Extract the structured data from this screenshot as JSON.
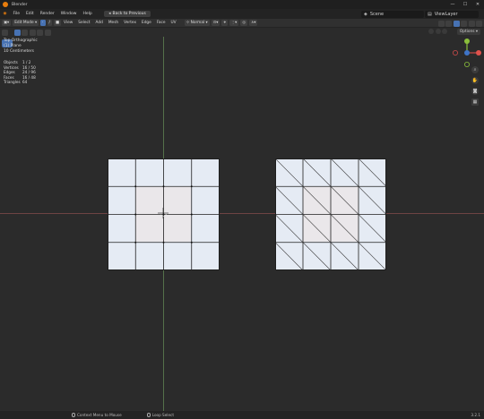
{
  "window": {
    "title": "Blender",
    "buttons": [
      "—",
      "☐",
      "✕"
    ]
  },
  "menubar": {
    "items": [
      "File",
      "Edit",
      "Render",
      "Window",
      "Help"
    ],
    "back_button": "Back to Previous",
    "scene": "Scene",
    "view_layer": "ViewLayer"
  },
  "header": {
    "mode": "Edit Mode",
    "menus": [
      "View",
      "Select",
      "Add",
      "Mesh",
      "Vertex",
      "Edge",
      "Face",
      "UV"
    ],
    "orientation": "Normal"
  },
  "options_label": "Options",
  "overlay": {
    "view": "Top Orthographic",
    "object": "(1) Plane",
    "scale": "10 Centimeters"
  },
  "stats": [
    {
      "label": "Objects",
      "value": "1 / 2"
    },
    {
      "label": "Vertices",
      "value": "16 / 50"
    },
    {
      "label": "Edges",
      "value": "24 / 96"
    },
    {
      "label": "Faces",
      "value": "16 / 48"
    },
    {
      "label": "Triangles",
      "value": "64"
    }
  ],
  "statusbar": {
    "item1": "Context Menu to Mouse",
    "item2": "Loop Select",
    "version": "3.2.1"
  },
  "colors": {
    "accent": "#4772b3",
    "face": "#e5ebf4",
    "axis_x": "#6e4444",
    "axis_y": "#55714a"
  }
}
